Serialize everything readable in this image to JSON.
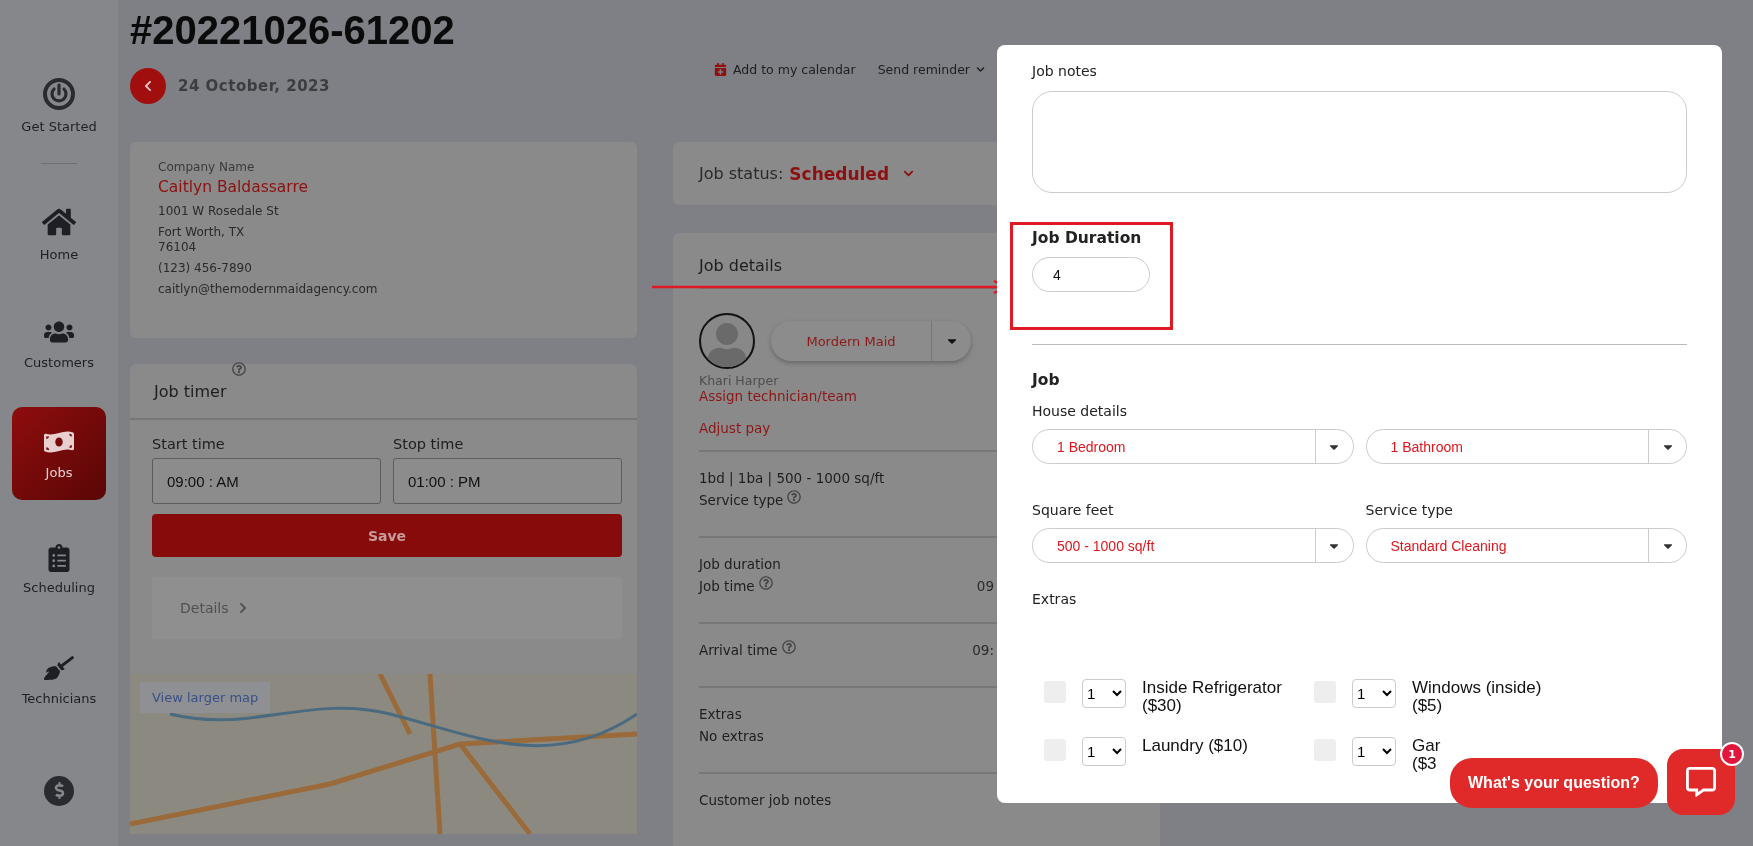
{
  "header": {
    "title": "#20221026-61202",
    "date": "24 October, 2023",
    "calendar": "Add to my calendar",
    "reminder": "Send reminder"
  },
  "sidebar": {
    "items": [
      {
        "label": "Get Started",
        "selected": false
      },
      {
        "label": "Home",
        "selected": false
      },
      {
        "label": "Customers",
        "selected": false
      },
      {
        "label": "Jobs",
        "selected": true
      },
      {
        "label": "Scheduling",
        "selected": false
      },
      {
        "label": "Technicians",
        "selected": false
      },
      {
        "selected": false
      }
    ]
  },
  "customer": {
    "caption": "Company Name",
    "name": "Caitlyn Baldassarre",
    "street": "1001 W Rosedale St",
    "city": "Fort Worth, TX",
    "zip": "76104",
    "phone": "(123) 456-7890",
    "email": "caitlyn@themodernmaidagency.com"
  },
  "job_timer": {
    "title": "Job timer",
    "start_label": "Start time",
    "start_value": "09:00 : AM",
    "stop_label": "Stop time",
    "stop_value": "01:00 : PM",
    "save": "Save",
    "details": "Details"
  },
  "map": {
    "link": "View larger map"
  },
  "job_status": {
    "label": "Job status:",
    "value": "Scheduled"
  },
  "job_details": {
    "title": "Job details",
    "team": "Mordern Maid",
    "technician": "Khari Harper",
    "links": [
      "Assign technician/team",
      "Adjust pay"
    ],
    "sections": [
      {
        "lines": [
          {
            "label": "1bd | 1ba | 500 - 1000 sq/ft",
            "help": false
          },
          {
            "label": "Service type",
            "help": true
          }
        ]
      },
      {
        "lines": [
          {
            "label": "Job duration",
            "help": false
          },
          {
            "label": "Job time",
            "help": true,
            "value": "09"
          }
        ]
      },
      {
        "lines": [
          {
            "label": "Arrival time",
            "help": true,
            "value": "09:"
          }
        ]
      },
      {
        "lines": [
          {
            "label": "Extras",
            "help": false
          },
          {
            "label": "No extras",
            "help": false
          }
        ]
      },
      {
        "lines": [
          {
            "label": "Customer job notes",
            "help": false
          }
        ]
      }
    ]
  },
  "modal": {
    "notes_label": "Job notes",
    "duration_label": "Job Duration",
    "duration_value": "4",
    "job_title": "Job",
    "selects": [
      {
        "label": "House details",
        "value": "1 Bedroom"
      },
      {
        "value": "1 Bathroom"
      },
      {
        "label": "Square feet",
        "value": "500 - 1000 sq/ft"
      },
      {
        "label": "Service type",
        "value": "Standard Cleaning"
      }
    ],
    "extras_label": "Extras",
    "extras": [
      {
        "lines": [
          "Inside Refrigerator",
          "($30)"
        ],
        "qty": "1",
        "checked": false
      },
      {
        "lines": [
          "Windows (inside)",
          "($5)"
        ],
        "qty": "1",
        "checked": false
      },
      {
        "lines": [
          "Laundry ($10)"
        ],
        "qty": "1",
        "checked": false
      },
      {
        "lines": [
          "Gar",
          "($3"
        ],
        "qty": "1",
        "checked": false
      }
    ]
  },
  "chat": {
    "prompt": "What's your question?",
    "badge": "1"
  }
}
